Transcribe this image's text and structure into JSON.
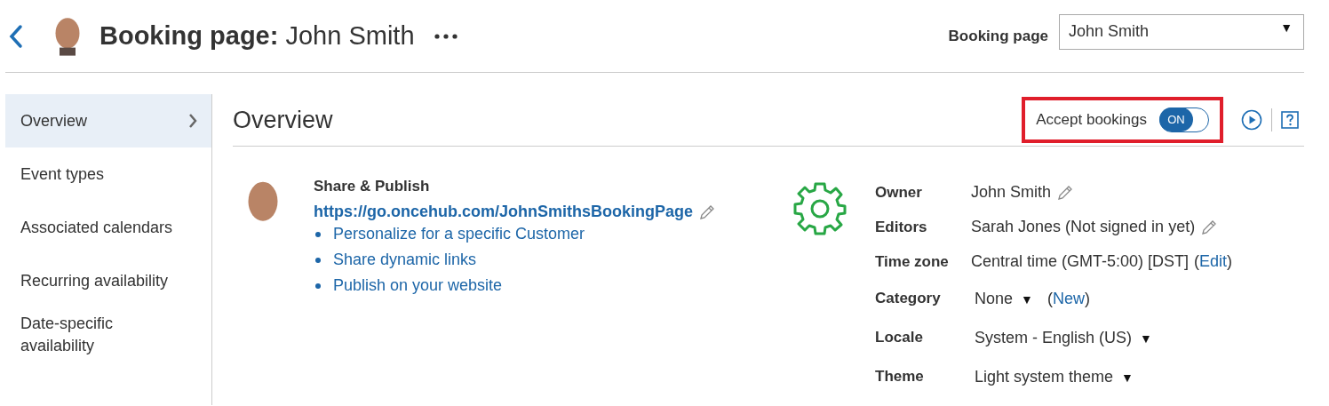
{
  "header": {
    "title_bold": "Booking page:",
    "title_name": "John Smith",
    "selector_label": "Booking page",
    "selector": {
      "value": "John Smith",
      "arrow": "▼"
    }
  },
  "sidebar": {
    "items": [
      {
        "label": "Overview",
        "selected": true
      },
      {
        "label": "Event types",
        "selected": false
      },
      {
        "label": "Associated calendars",
        "selected": false
      },
      {
        "label": "Recurring availability",
        "selected": false
      },
      {
        "label": "Date-specific availability",
        "selected": false
      }
    ]
  },
  "section": {
    "title": "Overview",
    "accept_bookings": {
      "label": "Accept bookings",
      "on": true,
      "state_text": "ON",
      "highlighted": true
    }
  },
  "share": {
    "heading": "Share & Publish",
    "url": "https://go.oncehub.com/JohnSmithsBookingPage",
    "links": [
      "Personalize for a specific Customer",
      "Share dynamic links",
      "Publish on your website"
    ]
  },
  "details": [
    {
      "label": "Owner",
      "kind": "text",
      "value": "John Smith",
      "editable": true
    },
    {
      "label": "Editors",
      "kind": "text",
      "value": "Sarah Jones (Not signed in yet)",
      "editable": true
    },
    {
      "label": "Time zone",
      "kind": "text",
      "value": "Central time (GMT-5:00) [DST]",
      "link_open": "(",
      "link": "Edit",
      "link_close": ")"
    },
    {
      "label": "Category",
      "kind": "dropdown",
      "value": "None",
      "arrow": "▼",
      "link_open": "(",
      "link": "New",
      "link_close": ")"
    },
    {
      "label": "Locale",
      "kind": "dropdown",
      "value": "System - English (US)",
      "arrow": "▼"
    },
    {
      "label": "Theme",
      "kind": "dropdown",
      "value": "Light system theme",
      "arrow": "▼"
    }
  ]
}
